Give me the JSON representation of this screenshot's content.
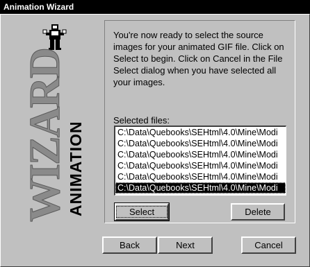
{
  "window": {
    "title": "Animation Wizard"
  },
  "art": {
    "wordmark_large": "WIZARD",
    "wordmark_small": "ANIMATION"
  },
  "instructions": "You're now ready to select the source\nimages for your animated GIF file. Click on\nSelect to begin. Click on Cancel in the File\nSelect dialog when you have selected all\nyour images.",
  "files": {
    "label": "Selected files:",
    "items": [
      "C:\\Data\\Quebooks\\SEHtml\\4.0\\Mine\\Modi",
      "C:\\Data\\Quebooks\\SEHtml\\4.0\\Mine\\Modi",
      "C:\\Data\\Quebooks\\SEHtml\\4.0\\Mine\\Modi",
      "C:\\Data\\Quebooks\\SEHtml\\4.0\\Mine\\Modi",
      "C:\\Data\\Quebooks\\SEHtml\\4.0\\Mine\\Modi",
      "C:\\Data\\Quebooks\\SEHtml\\4.0\\Mine\\Modi"
    ],
    "selected_index": 5
  },
  "buttons": {
    "select": "Select",
    "delete": "Delete",
    "back": "Back",
    "next": "Next",
    "cancel": "Cancel"
  }
}
